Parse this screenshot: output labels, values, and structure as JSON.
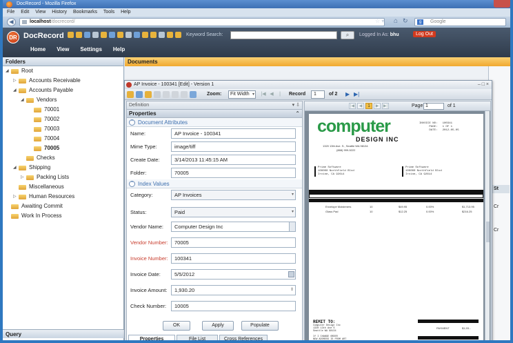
{
  "browser": {
    "title": "DocRecord - Mozilla Firefox",
    "menu": [
      "File",
      "Edit",
      "View",
      "History",
      "Bookmarks",
      "Tools",
      "Help"
    ],
    "url_host": "localhost",
    "url_path": "/docrecord/",
    "search_placeholder": "Google"
  },
  "app": {
    "name": "DocRecord",
    "logo_text": "DR",
    "keyword_label": "Keyword Search:",
    "keyword_value": "",
    "logged_label": "Logged In As:",
    "user": "bhu",
    "logout": "Log Out",
    "menu": [
      "Home",
      "View",
      "Settings",
      "Help"
    ]
  },
  "folders": {
    "header": "Folders",
    "items": [
      {
        "label": "Root",
        "level": 0,
        "toggle": "◢"
      },
      {
        "label": "Accounts Receivable",
        "level": 1,
        "toggle": "▷"
      },
      {
        "label": "Accounts Payable",
        "level": 1,
        "toggle": "◢"
      },
      {
        "label": "Vendors",
        "level": 2,
        "toggle": "◢"
      },
      {
        "label": "70001",
        "level": 3,
        "toggle": ""
      },
      {
        "label": "70002",
        "level": 3,
        "toggle": ""
      },
      {
        "label": "70003",
        "level": 3,
        "toggle": ""
      },
      {
        "label": "70004",
        "level": 3,
        "toggle": ""
      },
      {
        "label": "70005",
        "level": 3,
        "toggle": "",
        "selected": true
      },
      {
        "label": "Checks",
        "level": 2,
        "toggle": ""
      },
      {
        "label": "Shipping",
        "level": 1,
        "toggle": "◢"
      },
      {
        "label": "Packing Lists",
        "level": 2,
        "toggle": "▷"
      },
      {
        "label": "Miscellaneous",
        "level": 1,
        "toggle": ""
      },
      {
        "label": "Human Resources",
        "level": 1,
        "toggle": "▷"
      },
      {
        "label": "Awaiting Commit",
        "level": 0,
        "toggle": ""
      },
      {
        "label": "Work In Process",
        "level": 0,
        "toggle": ""
      }
    ],
    "query_header": "Query"
  },
  "documents": {
    "header": "Documents",
    "right_col": {
      "header": "St",
      "c1": "Cr",
      "c2": "Cr"
    }
  },
  "dialog": {
    "title": "AP Invoice - 100341 [Edit] - Version 1",
    "controls": "– □ ×",
    "zoom_label": "Zoom:",
    "zoom_value": "Fit Width",
    "record_label": "Record",
    "record_value": "1",
    "record_of": "of 2",
    "definition_label": "Definition",
    "properties_label": "Properties",
    "doc_attr_label": "Document Attributes",
    "index_values_label": "Index Values",
    "fields": {
      "name": {
        "label": "Name:",
        "value": "AP Invoice - 100341"
      },
      "mime": {
        "label": "Mime Type:",
        "value": "image/tiff"
      },
      "create": {
        "label": "Create Date:",
        "value": "3/14/2013 11:45:15 AM"
      },
      "folder": {
        "label": "Folder:",
        "value": "70005"
      },
      "category": {
        "label": "Category:",
        "value": "AP Invoices"
      },
      "status": {
        "label": "Status:",
        "value": "Paid"
      },
      "vendor_name": {
        "label": "Vendor Name:",
        "value": "Computer Design Inc"
      },
      "vendor_number": {
        "label": "Vendor Number:",
        "value": "70005"
      },
      "invoice_number": {
        "label": "Invoice Number:",
        "value": "100341"
      },
      "invoice_date": {
        "label": "Invoice Date:",
        "value": "5/5/2012"
      },
      "invoice_amount": {
        "label": "Invoice Amount:",
        "value": "1,930.20"
      },
      "check_number": {
        "label": "Check Number:",
        "value": "10005"
      }
    },
    "buttons": {
      "ok": "OK",
      "apply": "Apply",
      "populate": "Populate"
    },
    "tabs": [
      "Properties",
      "File List",
      "Cross References"
    ],
    "viewer": {
      "page_label": "Page",
      "page_value": "1",
      "page_of": "of 1",
      "current_page_btn": "1"
    }
  },
  "invoice": {
    "brand_top": "computer",
    "brand_bottom": "DESIGN INC",
    "addr1": "1320 13th Ave. S., Seattle WA 98134",
    "addr2": "(888) 999-5222",
    "meta": "INVOICE NO:   100341\n      PAGE:   1 OF 1\n      DATE:   2012-05-05",
    "ship1": "Prime Software\n100000 Northfield Blvd\nIrvine, CA 92614",
    "ship2": "Prime Software\n100000 Northfield Blvd\nIrvine, CA 92614",
    "line1": {
      "desc": "Envelope Moisteners",
      "qty": "10",
      "price": "$49.95",
      "pct": "0.00%",
      "total": "$1,713.95"
    },
    "line2": {
      "desc": "Glass Pad",
      "qty": "10",
      "price": "$12.25",
      "pct": "0.00%",
      "total": "$216.25"
    },
    "remit_title": "REMIT TO:",
    "remit_addr": "Computer Design Inc\n1320 13th Ave S\nSeattle WA 98134\n\nIf I CHANGE ORDER\nNEW ADDRESS IS FROM ART\nComputer 1000 Street Ave",
    "remit_lbl": "PAYMENT",
    "remit_amt": "$1,93..."
  },
  "colors": {
    "accent": "#f0a830",
    "brand_green": "#2a9a48",
    "logout": "#d23a1e"
  }
}
